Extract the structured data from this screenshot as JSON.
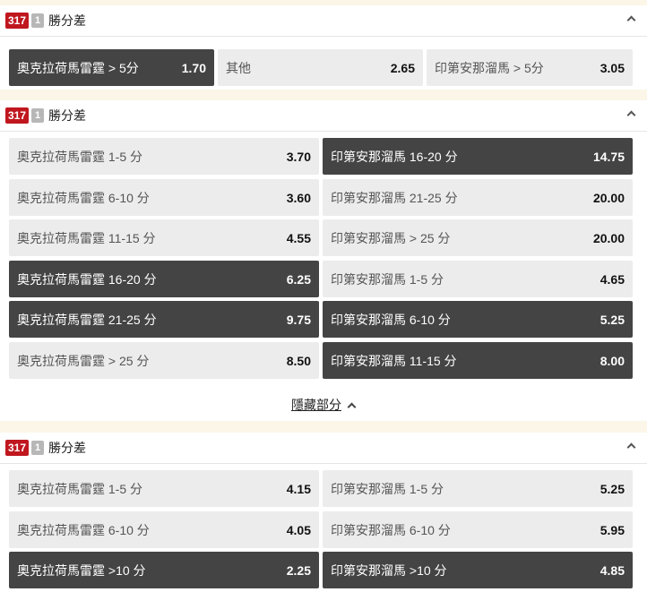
{
  "sections": [
    {
      "badge": "317",
      "sub": "1",
      "title": "勝分差",
      "cells": [
        {
          "label": "奧克拉荷馬雷霆 > 5分",
          "odds": "1.70",
          "selected": true
        },
        {
          "label": "其他",
          "odds": "2.65",
          "selected": false
        },
        {
          "label": "印第安那溜馬 > 5分",
          "odds": "3.05",
          "selected": false
        }
      ]
    },
    {
      "badge": "317",
      "sub": "1",
      "title": "勝分差",
      "cells": [
        {
          "label": "奧克拉荷馬雷霆 1-5 分",
          "odds": "3.70",
          "selected": false
        },
        {
          "label": "印第安那溜馬 16-20 分",
          "odds": "14.75",
          "selected": true
        },
        {
          "label": "奧克拉荷馬雷霆 6-10 分",
          "odds": "3.60",
          "selected": false
        },
        {
          "label": "印第安那溜馬 21-25 分",
          "odds": "20.00",
          "selected": false
        },
        {
          "label": "奧克拉荷馬雷霆 11-15 分",
          "odds": "4.55",
          "selected": false
        },
        {
          "label": "印第安那溜馬 > 25 分",
          "odds": "20.00",
          "selected": false
        },
        {
          "label": "奧克拉荷馬雷霆 16-20 分",
          "odds": "6.25",
          "selected": true
        },
        {
          "label": "印第安那溜馬 1-5 分",
          "odds": "4.65",
          "selected": false
        },
        {
          "label": "奧克拉荷馬雷霆 21-25 分",
          "odds": "9.75",
          "selected": true
        },
        {
          "label": "印第安那溜馬 6-10 分",
          "odds": "5.25",
          "selected": true
        },
        {
          "label": "奧克拉荷馬雷霆 > 25 分",
          "odds": "8.50",
          "selected": false
        },
        {
          "label": "印第安那溜馬 11-15 分",
          "odds": "8.00",
          "selected": true
        }
      ],
      "hide_label": "隱藏部分"
    },
    {
      "badge": "317",
      "sub": "1",
      "title": "勝分差",
      "cells": [
        {
          "label": "奧克拉荷馬雷霆 1-5 分",
          "odds": "4.15",
          "selected": false
        },
        {
          "label": "印第安那溜馬 1-5 分",
          "odds": "5.25",
          "selected": false
        },
        {
          "label": "奧克拉荷馬雷霆 6-10 分",
          "odds": "4.05",
          "selected": false
        },
        {
          "label": "印第安那溜馬 6-10 分",
          "odds": "5.95",
          "selected": false
        },
        {
          "label": "奧克拉荷馬雷霆 >10 分",
          "odds": "2.25",
          "selected": true
        },
        {
          "label": "印第安那溜馬 >10 分",
          "odds": "4.85",
          "selected": true
        }
      ]
    }
  ]
}
